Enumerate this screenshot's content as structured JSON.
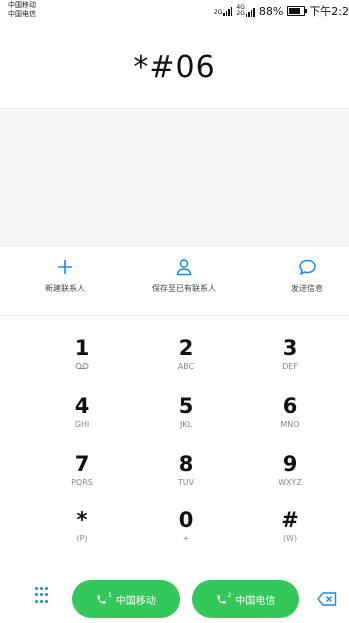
{
  "status_bar": {
    "carrier_1": "中国移动",
    "carrier_2": "中国电信",
    "net_type_1": "2G",
    "net_type_2": "4G",
    "net_type_3": "2G",
    "battery": "88%",
    "time": "下午2:2"
  },
  "display": {
    "number": "*#06"
  },
  "actions": [
    {
      "label": "新建联系人",
      "icon": "add-icon"
    },
    {
      "label": "保存至已有联系人",
      "icon": "person-icon"
    },
    {
      "label": "发送信息",
      "icon": "message-icon"
    }
  ],
  "keypad": [
    {
      "digit": "1",
      "letters": ""
    },
    {
      "digit": "2",
      "letters": "ABC"
    },
    {
      "digit": "3",
      "letters": "DEF"
    },
    {
      "digit": "4",
      "letters": "GHI"
    },
    {
      "digit": "5",
      "letters": "JKL"
    },
    {
      "digit": "6",
      "letters": "MNO"
    },
    {
      "digit": "7",
      "letters": "PQRS"
    },
    {
      "digit": "8",
      "letters": "TUV"
    },
    {
      "digit": "9",
      "letters": "WXYZ"
    },
    {
      "digit": "*",
      "letters": "(P)"
    },
    {
      "digit": "0",
      "letters": "+"
    },
    {
      "digit": "#",
      "letters": "(W)"
    }
  ],
  "call_buttons": [
    {
      "sim": "1",
      "label": "中国移动"
    },
    {
      "sim": "2",
      "label": "中国电信"
    }
  ],
  "colors": {
    "accent": "#1e88e5",
    "call_green": "#34c759",
    "battery_level": 0.88
  }
}
